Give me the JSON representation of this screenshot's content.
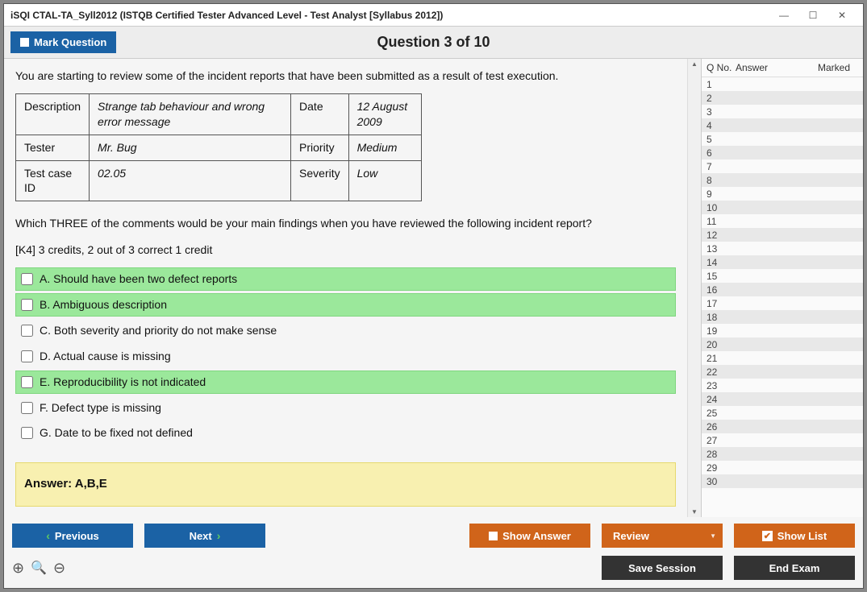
{
  "window": {
    "title": "iSQI CTAL-TA_Syll2012 (ISTQB Certified Tester Advanced Level - Test Analyst [Syllabus 2012])",
    "minimize_icon": "—",
    "maximize_icon": "☐",
    "close_icon": "✕"
  },
  "toolbar": {
    "mark_question_label": "Mark Question",
    "counter": "Question 3 of 10"
  },
  "question": {
    "intro": "You are starting to review some of the incident reports that have been submitted as a result of test execution.",
    "incident": {
      "r1c1": "Description",
      "r1c2": "Strange tab behaviour and wrong error message",
      "r1c3": "Date",
      "r1c4": "12 August 2009",
      "r2c1": "Tester",
      "r2c2": "Mr. Bug",
      "r2c3": "Priority",
      "r2c4": "Medium",
      "r3c1": "Test case ID",
      "r3c2": "02.05",
      "r3c3": "Severity",
      "r3c4": "Low"
    },
    "prompt": "Which THREE of the comments would be your main findings when you have reviewed the following incident report?",
    "credits": "[K4] 3 credits, 2 out of 3 correct 1 credit",
    "options": [
      {
        "key": "A",
        "text": "A. Should have been two defect reports",
        "correct": true
      },
      {
        "key": "B",
        "text": "B. Ambiguous description",
        "correct": true
      },
      {
        "key": "C",
        "text": "C. Both severity and priority do not make sense",
        "correct": false
      },
      {
        "key": "D",
        "text": "D. Actual cause is missing",
        "correct": false
      },
      {
        "key": "E",
        "text": "E. Reproducibility is not indicated",
        "correct": true
      },
      {
        "key": "F",
        "text": "F. Defect type is missing",
        "correct": false
      },
      {
        "key": "G",
        "text": "G. Date to be fixed not defined",
        "correct": false
      }
    ],
    "answer_label": "Answer: A,B,E"
  },
  "sidebar": {
    "h1": "Q No.",
    "h2": "Answer",
    "h3": "Marked",
    "rows": [
      1,
      2,
      3,
      4,
      5,
      6,
      7,
      8,
      9,
      10,
      11,
      12,
      13,
      14,
      15,
      16,
      17,
      18,
      19,
      20,
      21,
      22,
      23,
      24,
      25,
      26,
      27,
      28,
      29,
      30
    ]
  },
  "footer": {
    "previous": "Previous",
    "next": "Next",
    "show_answer": "Show Answer",
    "review": "Review",
    "show_list": "Show List",
    "save_session": "Save Session",
    "end_exam": "End Exam"
  },
  "colors": {
    "blue": "#1b62a5",
    "orange": "#d0641a",
    "dark": "#333333",
    "correct_bg": "#9be89b",
    "answer_bg": "#f8f0b0"
  }
}
